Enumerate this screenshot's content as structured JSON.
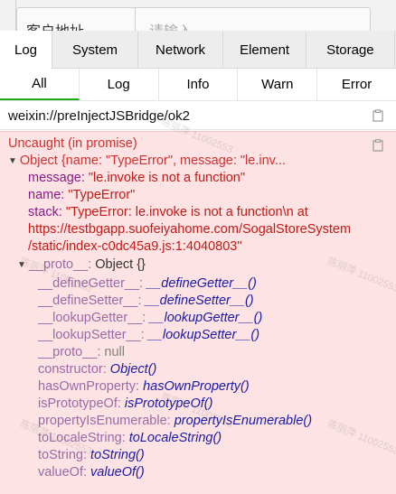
{
  "background_form": {
    "label": "客户地址",
    "placeholder": "请输入"
  },
  "top_tabs": [
    "Log",
    "System",
    "Network",
    "Element",
    "Storage"
  ],
  "sub_tabs": [
    "All",
    "Log",
    "Info",
    "Warn",
    "Error"
  ],
  "log_entry": {
    "text": "weixin://preInjectJSBridge/ok2"
  },
  "error": {
    "title": "Uncaught (in promise)",
    "object_summary": "Object {name: \"TypeError\", message: \"le.inv...",
    "message_key": "message",
    "message_value": "\"le.invoke is not a function\"",
    "name_key": "name",
    "name_value": "\"TypeError\"",
    "stack_key": "stack",
    "stack_line1": "\"TypeError: le.invoke is not a function\\n at",
    "stack_line2": "https://testbgapp.suofeiyahome.com/SogalStoreSystem",
    "stack_line3": "/static/index-c0dc45a9.js:1:4040803\"",
    "proto_key": "__proto__",
    "proto_value": "Object {}",
    "proto_items": [
      {
        "key": "__defineGetter__",
        "value": "__defineGetter__()"
      },
      {
        "key": "__defineSetter__",
        "value": "__defineSetter__()"
      },
      {
        "key": "__lookupGetter__",
        "value": "__lookupGetter__()"
      },
      {
        "key": "__lookupSetter__",
        "value": "__lookupSetter__()"
      },
      {
        "key": "__proto__",
        "value": "null"
      },
      {
        "key": "constructor",
        "value": "Object()"
      },
      {
        "key": "hasOwnProperty",
        "value": "hasOwnProperty()"
      },
      {
        "key": "isPrototypeOf",
        "value": "isPrototypeOf()"
      },
      {
        "key": "propertyIsEnumerable",
        "value": "propertyIsEnumerable()"
      },
      {
        "key": "toLocaleString",
        "value": "toLocaleString()"
      },
      {
        "key": "toString",
        "value": "toString()"
      },
      {
        "key": "valueOf",
        "value": "valueOf()"
      }
    ]
  },
  "watermark_text": "陈丽萍 11002553",
  "colors": {
    "active_tab_underline": "#1aad19",
    "error_background": "#fde3e3",
    "error_text": "#d03030"
  }
}
